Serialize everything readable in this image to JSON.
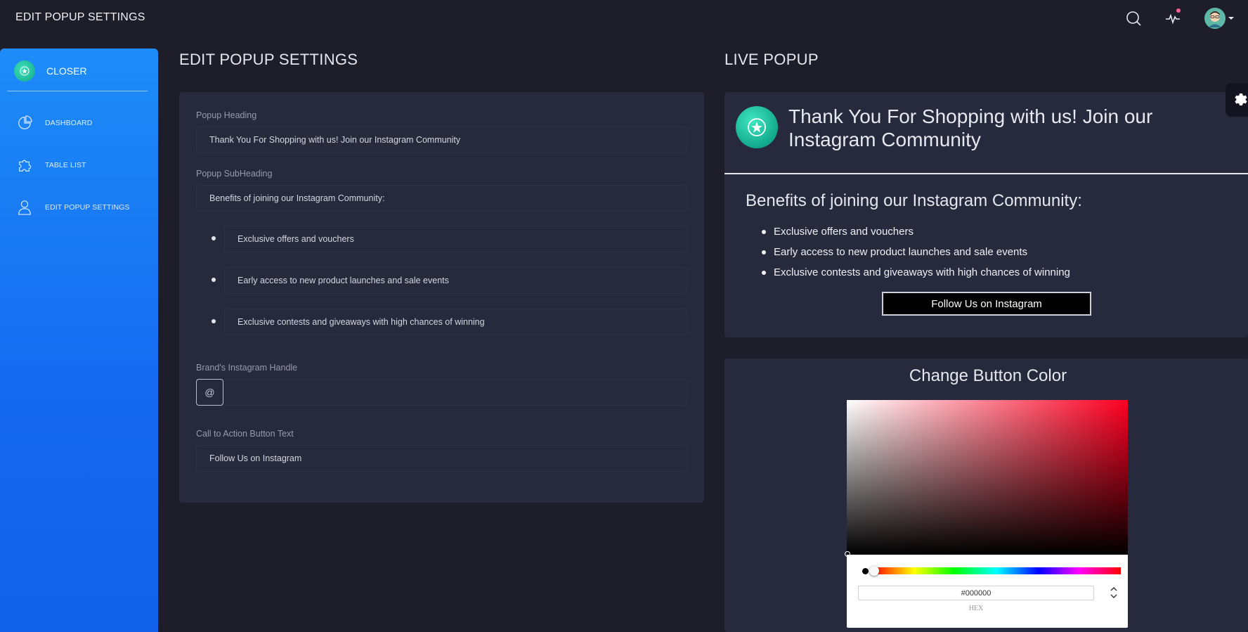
{
  "topbar": {
    "title": "EDIT POPUP SETTINGS"
  },
  "sidebar": {
    "brand": "CLOSER",
    "items": [
      {
        "label": "DASHBOARD",
        "icon": "pie-chart-icon"
      },
      {
        "label": "TABLE LIST",
        "icon": "puzzle-icon"
      },
      {
        "label": "EDIT POPUP SETTINGS",
        "icon": "user-icon"
      }
    ]
  },
  "editor": {
    "title": "EDIT POPUP SETTINGS",
    "heading_label": "Popup Heading",
    "heading_value": "Thank You For Shopping with us! Join our Instagram Community",
    "subheading_label": "Popup SubHeading",
    "subheading_value": "Benefits of joining our Instagram Community:",
    "benefits": [
      "Exclusive offers and vouchers",
      "Early access to new product launches and sale events",
      "Exclusive contests and giveaways with high chances of winning"
    ],
    "handle_label": "Brand's Instagram Handle",
    "handle_prefix": "@",
    "handle_value": "",
    "cta_label": "Call to Action Button Text",
    "cta_value": "Follow Us on Instagram"
  },
  "live": {
    "title": "LIVE POPUP",
    "heading": "Thank You For Shopping with us! Join our Instagram Community",
    "subheading": "Benefits of joining our Instagram Community:",
    "benefits": [
      "Exclusive offers and vouchers",
      "Early access to new product launches and sale events",
      "Exclusive contests and giveaways with high chances of winning"
    ],
    "button": "Follow Us on Instagram"
  },
  "color_picker": {
    "title": "Change Button Color",
    "hex_value": "#000000",
    "mode_label": "HEX",
    "hue_color": "#ff0022",
    "selected_color": "#000000"
  },
  "colors": {
    "background": "#1e1e2b",
    "card": "#27293d",
    "sidebar_top": "#1d8cf8",
    "accent_green": "#12a98b",
    "notification": "#fd5d93"
  }
}
